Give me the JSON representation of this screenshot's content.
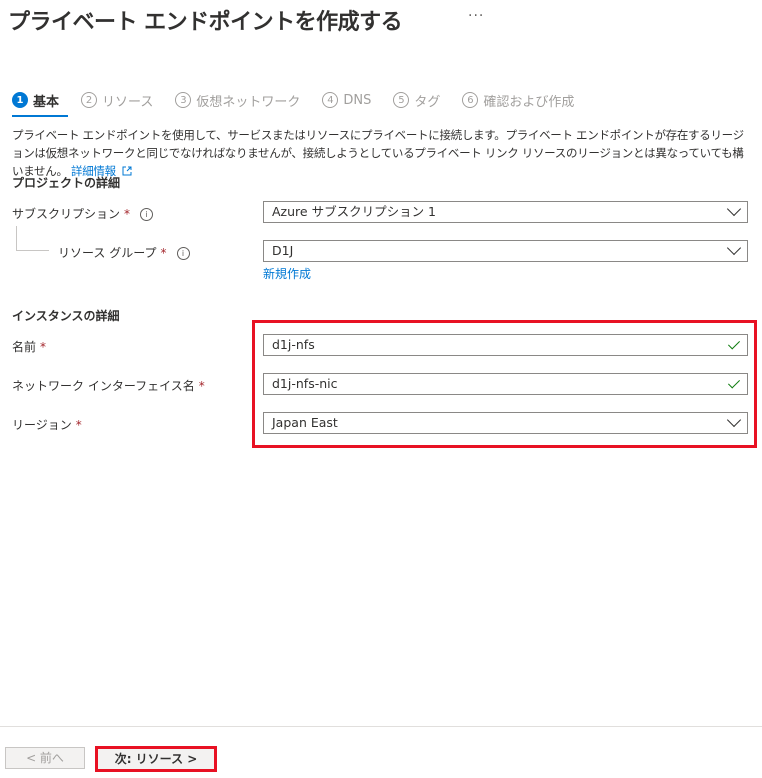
{
  "header": {
    "title": "プライベート エンドポイントを作成する",
    "more": "···"
  },
  "steps": [
    {
      "num": "1",
      "label": "基本"
    },
    {
      "num": "2",
      "label": "リソース"
    },
    {
      "num": "3",
      "label": "仮想ネットワーク"
    },
    {
      "num": "4",
      "label": "DNS"
    },
    {
      "num": "5",
      "label": "タグ"
    },
    {
      "num": "6",
      "label": "確認および作成"
    }
  ],
  "description": {
    "text": "プライベート エンドポイントを使用して、サービスまたはリソースにプライベートに接続します。プライベート エンドポイントが存在するリージョンは仮想ネットワークと同じでなければなりませんが、接続しようとしているプライベート リンク リソースのリージョンとは異なっていても構いません。",
    "link": "詳細情報"
  },
  "project": {
    "heading": "プロジェクトの詳細",
    "subscription_label": "サブスクリプション",
    "subscription_value": "Azure サブスクリプション 1",
    "resource_group_label": "リソース グループ",
    "resource_group_value": "D1J",
    "create_new": "新規作成"
  },
  "instance": {
    "heading": "インスタンスの詳細",
    "name_label": "名前",
    "name_value": "d1j-nfs",
    "nic_label": "ネットワーク インターフェイス名",
    "nic_value": "d1j-nfs-nic",
    "region_label": "リージョン",
    "region_value": "Japan East"
  },
  "common": {
    "required": "*",
    "info": "i"
  },
  "footer": {
    "prev_label": "< 前へ",
    "next_label": "次: リソース >"
  }
}
